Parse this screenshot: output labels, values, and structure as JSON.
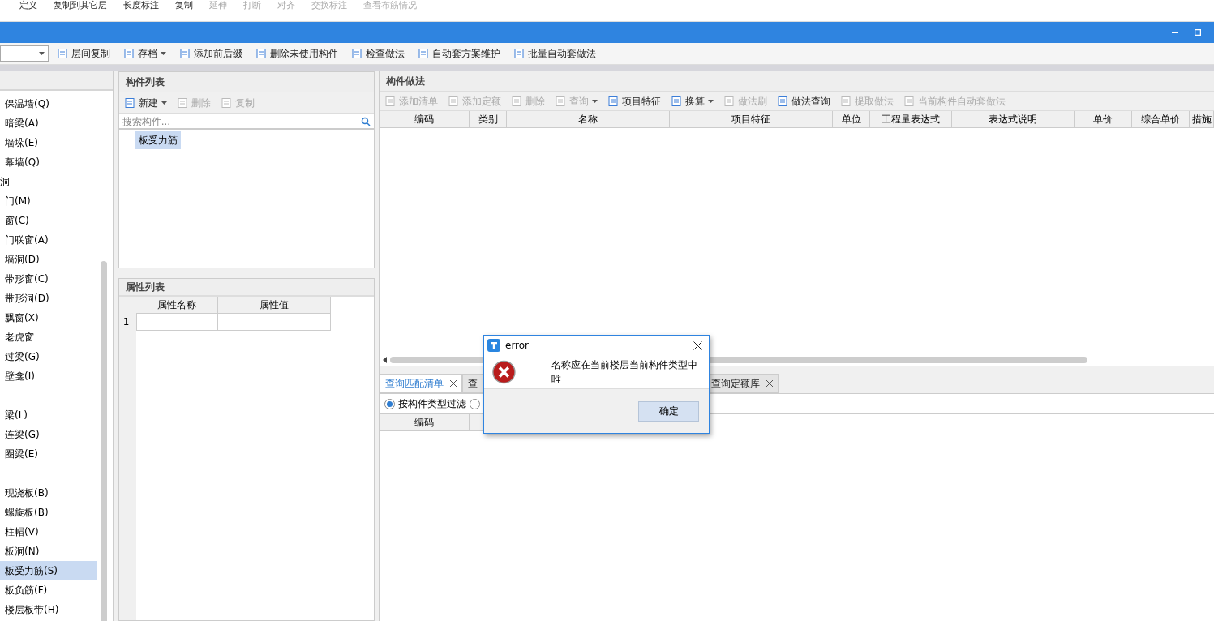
{
  "ribbon": [
    {
      "label": "定义",
      "disabled": false
    },
    {
      "label": "复制到其它层",
      "disabled": false
    },
    {
      "label": "长度标注",
      "disabled": false
    },
    {
      "label": "复制",
      "disabled": false
    },
    {
      "label": "延伸",
      "disabled": true
    },
    {
      "label": "打断",
      "disabled": true
    },
    {
      "label": "对齐",
      "disabled": true
    },
    {
      "label": "交换标注",
      "disabled": true
    },
    {
      "label": "查看布筋情况",
      "disabled": true
    }
  ],
  "toolbar": [
    {
      "label": "层间复制",
      "dropdown": false
    },
    {
      "label": "存档",
      "dropdown": true
    },
    {
      "label": "添加前后缀",
      "dropdown": false
    },
    {
      "label": "删除未使用构件",
      "dropdown": false
    },
    {
      "label": "检查做法",
      "dropdown": false
    },
    {
      "label": "自动套方案维护",
      "dropdown": false
    },
    {
      "label": "批量自动套做法",
      "dropdown": false
    }
  ],
  "sidebar": {
    "groups": [
      {
        "children": [
          {
            "label": "保温墙(Q)",
            "selected": false
          },
          {
            "label": "暗梁(A)",
            "selected": false
          },
          {
            "label": "墙垛(E)",
            "selected": false
          },
          {
            "label": "幕墙(Q)",
            "selected": false
          }
        ]
      },
      {
        "label": "洞",
        "children": [
          {
            "label": "门(M)",
            "selected": false
          },
          {
            "label": "窗(C)",
            "selected": false
          },
          {
            "label": "门联窗(A)",
            "selected": false
          },
          {
            "label": "墙洞(D)",
            "selected": false
          },
          {
            "label": "带形窗(C)",
            "selected": false
          },
          {
            "label": "带形洞(D)",
            "selected": false
          },
          {
            "label": "飘窗(X)",
            "selected": false
          },
          {
            "label": "老虎窗",
            "selected": false
          },
          {
            "label": "过梁(G)",
            "selected": false
          },
          {
            "label": "壁龛(I)",
            "selected": false
          }
        ]
      },
      {
        "children": [
          {
            "label": "梁(L)",
            "selected": false
          },
          {
            "label": "连梁(G)",
            "selected": false
          },
          {
            "label": "圈梁(E)",
            "selected": false
          }
        ]
      },
      {
        "children": [
          {
            "label": "现浇板(B)",
            "selected": false
          },
          {
            "label": "螺旋板(B)",
            "selected": false
          },
          {
            "label": "柱帽(V)",
            "selected": false
          },
          {
            "label": "板洞(N)",
            "selected": false
          },
          {
            "label": "板受力筋(S)",
            "selected": true
          },
          {
            "label": "板负筋(F)",
            "selected": false
          },
          {
            "label": "楼层板带(H)",
            "selected": false
          }
        ]
      }
    ]
  },
  "component_list": {
    "title": "构件列表",
    "tools": [
      {
        "label": "新建",
        "disabled": false,
        "dropdown": true
      },
      {
        "label": "删除",
        "disabled": true,
        "dropdown": false
      },
      {
        "label": "复制",
        "disabled": true,
        "dropdown": false
      }
    ],
    "search": {
      "placeholder": "搜索构件..."
    },
    "items": [
      {
        "label": "板受力筋",
        "selected": true
      }
    ]
  },
  "property_list": {
    "title": "属性列表",
    "columns": [
      "属性名称",
      "属性值"
    ],
    "rows": [
      {
        "index": "1"
      }
    ]
  },
  "method_panel": {
    "title": "构件做法",
    "tools": [
      {
        "label": "添加清单",
        "disabled": true,
        "dropdown": false
      },
      {
        "label": "添加定额",
        "disabled": true,
        "dropdown": false
      },
      {
        "label": "删除",
        "disabled": true,
        "dropdown": false
      },
      {
        "label": "查询",
        "disabled": true,
        "dropdown": true
      },
      {
        "label": "项目特征",
        "disabled": false,
        "dropdown": false
      },
      {
        "label": "换算",
        "disabled": false,
        "dropdown": true
      },
      {
        "label": "做法刷",
        "disabled": true,
        "dropdown": false
      },
      {
        "label": "做法查询",
        "disabled": false,
        "dropdown": false
      },
      {
        "label": "提取做法",
        "disabled": true,
        "dropdown": false
      },
      {
        "label": "当前构件自动套做法",
        "disabled": true,
        "dropdown": false
      }
    ],
    "columns": [
      "编码",
      "类别",
      "名称",
      "项目特征",
      "单位",
      "工程量表达式",
      "表达式说明",
      "单价",
      "综合单价",
      "措施"
    ]
  },
  "bottom_tabs": [
    {
      "label": "查询匹配清单",
      "selected": true
    },
    {
      "label": "查",
      "selected": false
    },
    {
      "label": "查询定额库",
      "selected": false
    }
  ],
  "filter": [
    {
      "label": "按构件类型过滤",
      "selected": true
    },
    {
      "selected": false
    }
  ],
  "bottom_columns": [
    "编码"
  ],
  "dialog": {
    "title": "error",
    "message": "名称应在当前楼层当前构件类型中唯一",
    "button": "确定"
  }
}
